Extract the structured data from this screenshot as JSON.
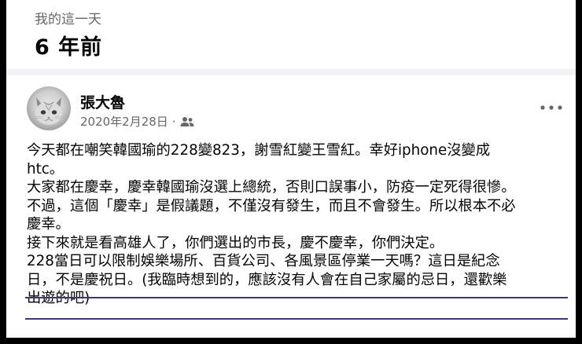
{
  "memory": {
    "label": "我的這一天",
    "title": "6 年前"
  },
  "post": {
    "author": "張大魯",
    "date": "2020年2月28日",
    "separator": "·",
    "audience_icon": "friends-icon",
    "more_icon": "more-options-icon",
    "lines": [
      "今天都在嘲笑韓國瑜的228變823，謝雪紅變王雪紅。幸好iphone沒變成",
      "htc。",
      "大家都在慶幸，慶幸韓國瑜沒選上總統，否則口誤事小，防疫一定死得很慘。",
      "不過，這個「慶幸」是假議題，不僅沒有發生，而且不會發生。所以根本不必",
      "慶幸。",
      "接下來就是看高雄人了，你們選出的市長，慶不慶幸，你們決定。",
      "228當日可以限制娛樂場所、百貨公司、各風景區停業一天嗎？這日是紀念",
      "日，不是慶祝日。(我臨時想到的，應該沒有人會在自己家屬的忌日，還歡樂",
      "出遊的吧)"
    ]
  },
  "colors": {
    "underline": "#3b3779",
    "secondary_text": "#65676b",
    "page_bg": "#f0f2f5"
  }
}
